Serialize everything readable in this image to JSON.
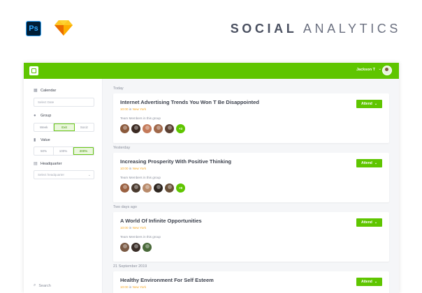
{
  "hero": {
    "title_bold": "SOCIAL",
    "title_light": "ANALYTICS",
    "ps_logo": "Ps",
    "sketch_icon": "sketch-diamond-icon"
  },
  "topbar": {
    "user_name": "Jackson T",
    "chevron": "⌄",
    "accent": "#5fc500"
  },
  "sidebar": {
    "calendar_label": "Calendar",
    "calendar_placeholder": "Select Date",
    "group_label": "Group",
    "group_options": [
      "Week",
      "Exit",
      "Sociz"
    ],
    "group_active": 1,
    "value_label": "Value",
    "value_options": [
      "50%",
      "100%",
      "200%"
    ],
    "value_active": 2,
    "headquarter_label": "Headquarter",
    "headquarter_placeholder": "Select headquarter",
    "search_label": "Search"
  },
  "feed": {
    "team_label": "Team Members in this group",
    "attend_label": "Attend",
    "sections": [
      {
        "day": "Today",
        "title": "Internet Advertising Trends You Won T Be Disappointed",
        "time": "10:00",
        "in": "in",
        "location": "New York",
        "avatars": [
          "#8b5a3c",
          "#3b2a22",
          "#c47a5a",
          "#a0684a",
          "#5b4032"
        ],
        "more": "+3"
      },
      {
        "day": "Yesterday",
        "title": "Increasing Prosperity With Positive Thinking",
        "time": "10:00",
        "in": "in",
        "location": "New York",
        "avatars": [
          "#9a6040",
          "#4a3a2e",
          "#b88a6a",
          "#2e2620",
          "#6a5038"
        ],
        "more": "+8"
      },
      {
        "day": "Two days ago",
        "title": "A World Of Infinite Opportunities",
        "time": "10:00",
        "in": "in",
        "location": "New York",
        "avatars": [
          "#7a5a44",
          "#3a2e28",
          "#4a6a3a"
        ],
        "more": ""
      },
      {
        "day": "21 September 2019",
        "title": "Healthy Environment For Self Esteem",
        "time": "10:00",
        "in": "in",
        "location": "New York",
        "avatars": [],
        "more": ""
      }
    ]
  }
}
